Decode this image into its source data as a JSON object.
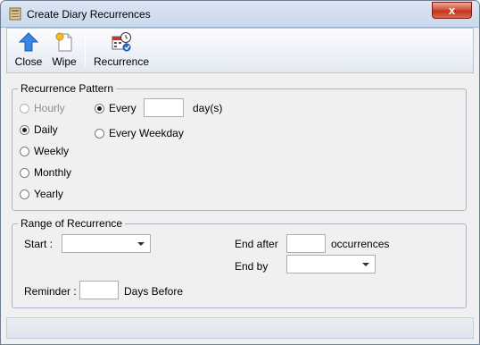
{
  "window": {
    "title": "Create Diary Recurrences",
    "close_glyph": "x"
  },
  "toolbar": {
    "close_label": "Close",
    "wipe_label": "Wipe",
    "recurrence_label": "Recurrence"
  },
  "pattern": {
    "legend": "Recurrence Pattern",
    "options": [
      "Hourly",
      "Daily",
      "Weekly",
      "Monthly",
      "Yearly"
    ],
    "selected": "Daily",
    "every_label": "Every",
    "every_value": "",
    "days_unit": "day(s)",
    "every_weekday_label": "Every Weekday"
  },
  "range": {
    "legend": "Range of Recurrence",
    "start_label": "Start :",
    "start_value": "",
    "end_after_label": "End after",
    "end_after_value": "",
    "occurrences_label": "occurrences",
    "end_by_label": "End by",
    "end_by_value": "",
    "reminder_label": "Reminder :",
    "reminder_value": "",
    "days_before_label": "Days Before"
  },
  "colors": {
    "accent": "#2a6ed6",
    "close_red": "#c3351d"
  }
}
